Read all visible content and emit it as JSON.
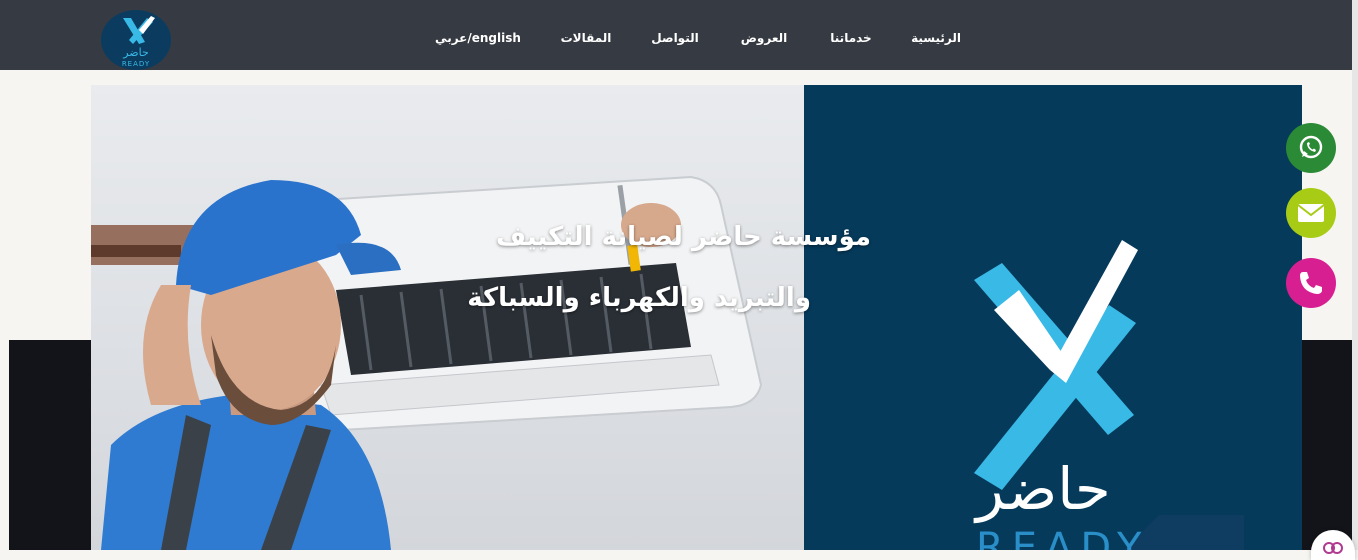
{
  "header": {
    "logo": {
      "text_ar": "حاضر",
      "text_en": "READY"
    },
    "nav": [
      {
        "label": "الرئيسية"
      },
      {
        "label": "خدماتنا"
      },
      {
        "label": "العروض"
      },
      {
        "label": "التواصل"
      },
      {
        "label": "المقالات"
      },
      {
        "label": "عربي/english"
      }
    ]
  },
  "hero": {
    "title_line1": "مؤسسة حاضر لصيانة التكييف",
    "title_line2": "والتبريد والكهرباء والسباكة",
    "brand_ar": "حاضر",
    "brand_en": "READY"
  },
  "floating": {
    "whatsapp": {
      "icon": "whatsapp-icon",
      "color": "#2b8a36"
    },
    "email": {
      "icon": "envelope-icon",
      "color": "#a8cc16"
    },
    "phone": {
      "icon": "phone-icon",
      "color": "#d81f92"
    }
  },
  "colors": {
    "topbar": "#363a43",
    "brand_panel": "#063a5b",
    "brand_cyan": "#39b9e6"
  }
}
